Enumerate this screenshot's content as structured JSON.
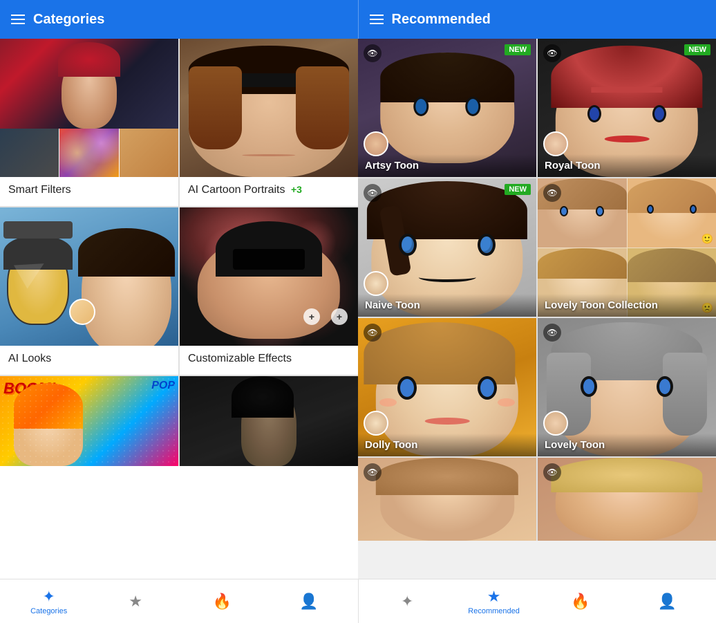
{
  "header": {
    "left_title": "Categories",
    "right_title": "Recommended"
  },
  "categories": {
    "items": [
      {
        "id": "smart-filters",
        "label": "Smart Filters",
        "badge": ""
      },
      {
        "id": "ai-cartoon-portraits",
        "label": "AI Cartoon Portraits",
        "badge": "+3"
      },
      {
        "id": "ai-looks",
        "label": "AI Looks",
        "badge": ""
      },
      {
        "id": "customizable-effects",
        "label": "Customizable Effects",
        "badge": ""
      },
      {
        "id": "comic-art",
        "label": "",
        "badge": ""
      },
      {
        "id": "dark-art",
        "label": "",
        "badge": ""
      }
    ]
  },
  "recommended": {
    "items": [
      {
        "id": "artsy-toon",
        "label": "Artsy Toon",
        "is_new": true
      },
      {
        "id": "royal-toon",
        "label": "Royal Toon",
        "is_new": true
      },
      {
        "id": "naive-toon",
        "label": "Naive Toon",
        "is_new": true
      },
      {
        "id": "lovely-toon-collection",
        "label": "Lovely Toon Collection",
        "is_new": false
      },
      {
        "id": "dolly-toon",
        "label": "Dolly Toon",
        "is_new": false
      },
      {
        "id": "lovely-toon",
        "label": "Lovely Toon",
        "is_new": false
      }
    ]
  },
  "bottom_nav": {
    "left": [
      {
        "id": "categories",
        "label": "Categories",
        "active": true,
        "icon": "✦"
      },
      {
        "id": "favorites",
        "label": "",
        "active": false,
        "icon": "★"
      },
      {
        "id": "trending",
        "label": "",
        "active": false,
        "icon": "🔥"
      },
      {
        "id": "profile",
        "label": "",
        "active": false,
        "icon": "👤"
      }
    ],
    "right": [
      {
        "id": "effects",
        "label": "",
        "active": false,
        "icon": "✦"
      },
      {
        "id": "recommended-nav",
        "label": "Recommended",
        "active": true,
        "icon": "★"
      },
      {
        "id": "trending2",
        "label": "",
        "active": false,
        "icon": "🔥"
      },
      {
        "id": "profile2",
        "label": "",
        "active": false,
        "icon": "👤"
      }
    ]
  },
  "labels": {
    "new": "NEW"
  }
}
